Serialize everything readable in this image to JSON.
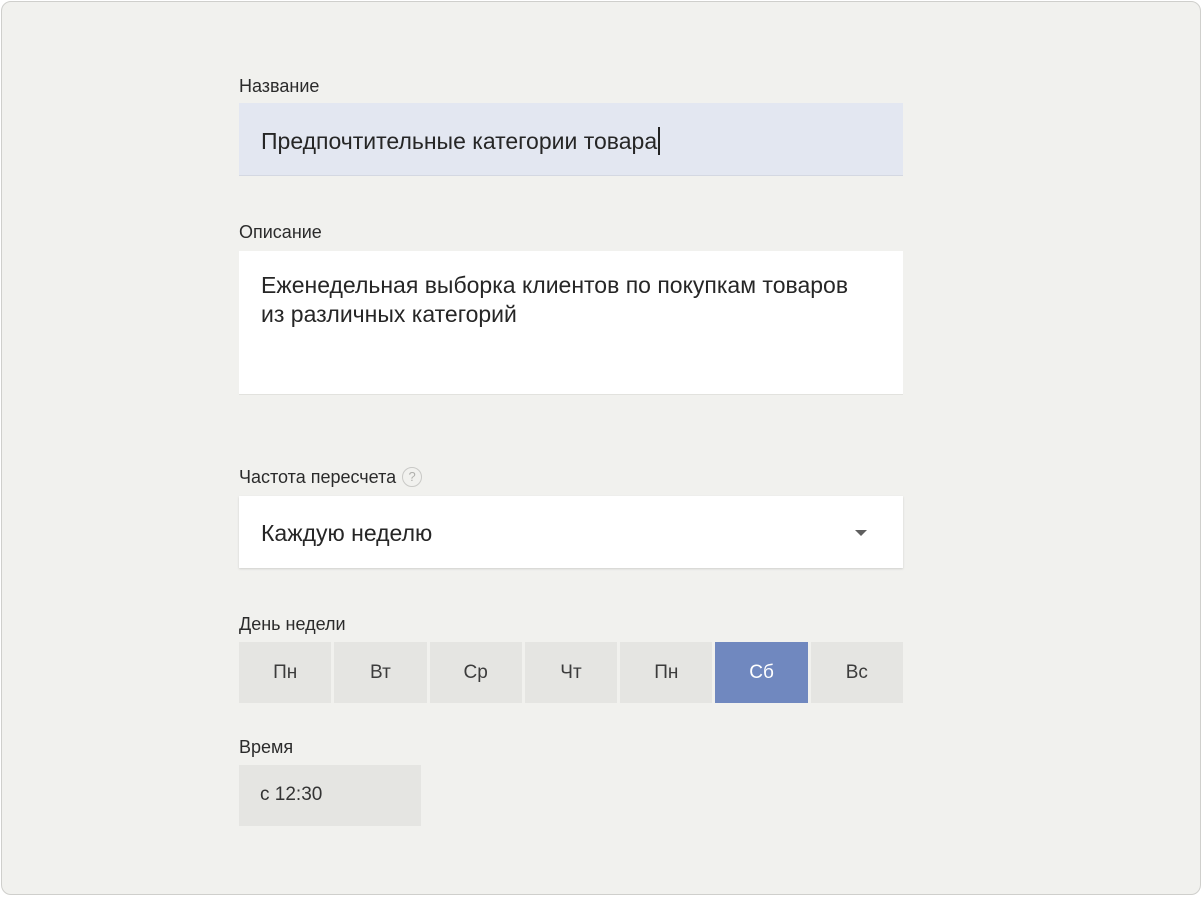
{
  "form": {
    "name": {
      "label": "Название",
      "value": "Предпочтительные категории товара"
    },
    "description": {
      "label": "Описание",
      "value": "Еженедельная выборка клиентов по покупкам товаров из различных категорий"
    },
    "frequency": {
      "label": "Частота пересчета",
      "help_icon": "?",
      "selected": "Каждую неделю"
    },
    "weekday": {
      "label": "День недели",
      "days": [
        "Пн",
        "Вт",
        "Ср",
        "Чт",
        "Пн",
        "Сб",
        "Вс"
      ],
      "selected_index": 5
    },
    "time": {
      "label": "Время",
      "value": "с 12:30"
    }
  },
  "colors": {
    "background": "#f1f1ee",
    "name_field_bg": "#e3e7f1",
    "day_button_bg": "#e5e5e2",
    "day_active_bg": "#7088bf"
  }
}
